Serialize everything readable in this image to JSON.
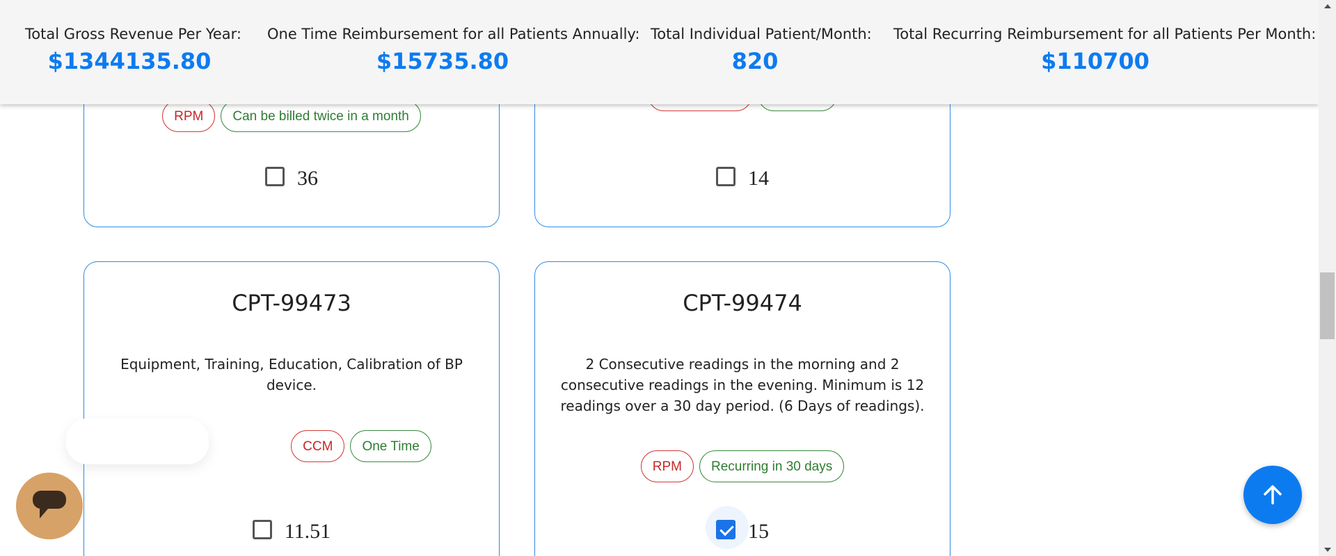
{
  "summary": {
    "items": [
      {
        "label": "Total Gross Revenue Per Year:",
        "value": "$1344135.80"
      },
      {
        "label": "One Time Reimbursement for all Patients Annually:",
        "value": "$15735.80"
      },
      {
        "label": "Total Individual Patient/Month:",
        "value": "820"
      },
      {
        "label": "Total Recurring Reimbursement for all Patients Per Month:",
        "value": "$110700"
      }
    ]
  },
  "cards": [
    {
      "tags": [
        {
          "text": "RPM",
          "color": "red"
        },
        {
          "text": "Can be billed twice in a month",
          "color": "green"
        }
      ],
      "value": "36",
      "checked": false
    },
    {
      "tags": [],
      "value": "14",
      "checked": false
    },
    {
      "title": "CPT-99473",
      "description": "Equipment, Training, Education, Calibration of BP device.",
      "tags": [
        {
          "text": "CCM",
          "color": "red"
        },
        {
          "text": "One Time",
          "color": "green"
        }
      ],
      "value": "11.51",
      "checked": false
    },
    {
      "title": "CPT-99474",
      "description": "2 Consecutive readings in the morning and 2 consecutive readings in the evening. Minimum is 12 readings over a 30 day period. (6 Days of readings).",
      "tags": [
        {
          "text": "RPM",
          "color": "red"
        },
        {
          "text": "Recurring in 30 days",
          "color": "green"
        }
      ],
      "value": "15",
      "checked": true
    }
  ],
  "colors": {
    "accent": "#0d7bf0",
    "card_border": "#2f8be6",
    "tag_red": "#c62828",
    "tag_green": "#2e7d32",
    "chat_launcher": "#d7a267"
  },
  "icons": {
    "scroll_top": "arrow-up-icon",
    "chat": "chat-bubble-icon"
  }
}
